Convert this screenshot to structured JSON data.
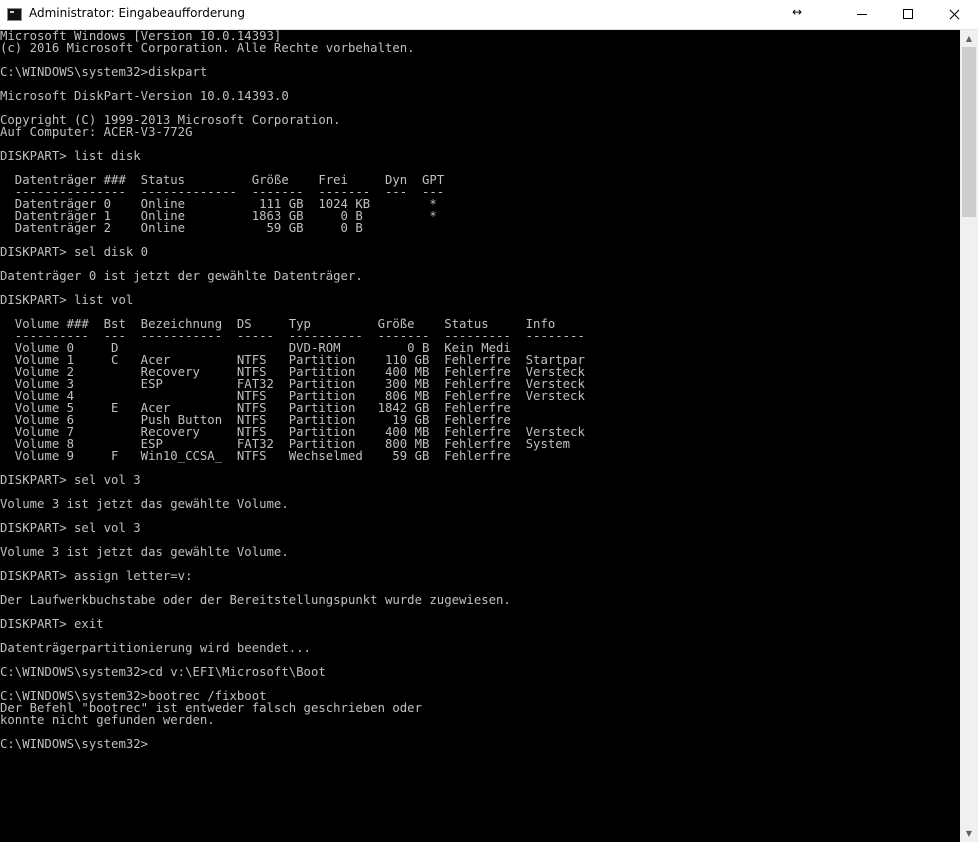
{
  "window": {
    "title": "Administrator: Eingabeaufforderung",
    "resize_glyph": "↔"
  },
  "console": {
    "lines": [
      "Microsoft Windows [Version 10.0.14393]",
      "(c) 2016 Microsoft Corporation. Alle Rechte vorbehalten.",
      "",
      "C:\\WINDOWS\\system32>diskpart",
      "",
      "Microsoft DiskPart-Version 10.0.14393.0",
      "",
      "Copyright (C) 1999-2013 Microsoft Corporation.",
      "Auf Computer: ACER-V3-772G",
      "",
      "DISKPART> list disk",
      "",
      "  Datenträger ###  Status         Größe    Frei     Dyn  GPT",
      "  ---------------  -------------  -------  -------  ---  ---",
      "  Datenträger 0    Online          111 GB  1024 KB        *",
      "  Datenträger 1    Online         1863 GB     0 B         *",
      "  Datenträger 2    Online           59 GB     0 B",
      "",
      "DISKPART> sel disk 0",
      "",
      "Datenträger 0 ist jetzt der gewählte Datenträger.",
      "",
      "DISKPART> list vol",
      "",
      "  Volume ###  Bst  Bezeichnung  DS     Typ         Größe    Status     Info",
      "  ----------  ---  -----------  -----  ----------  -------  ---------  --------",
      "  Volume 0     D                       DVD-ROM         0 B  Kein Medi",
      "  Volume 1     C   Acer         NTFS   Partition    110 GB  Fehlerfre  Startpar",
      "  Volume 2         Recovery     NTFS   Partition    400 MB  Fehlerfre  Versteck",
      "  Volume 3         ESP          FAT32  Partition    300 MB  Fehlerfre  Versteck",
      "  Volume 4                      NTFS   Partition    806 MB  Fehlerfre  Versteck",
      "  Volume 5     E   Acer         NTFS   Partition   1842 GB  Fehlerfre",
      "  Volume 6         Push Button  NTFS   Partition     19 GB  Fehlerfre",
      "  Volume 7         Recovery     NTFS   Partition    400 MB  Fehlerfre  Versteck",
      "  Volume 8         ESP          FAT32  Partition    800 MB  Fehlerfre  System",
      "  Volume 9     F   Win10_CCSA_  NTFS   Wechselmed    59 GB  Fehlerfre",
      "",
      "DISKPART> sel vol 3",
      "",
      "Volume 3 ist jetzt das gewählte Volume.",
      "",
      "DISKPART> sel vol 3",
      "",
      "Volume 3 ist jetzt das gewählte Volume.",
      "",
      "DISKPART> assign letter=v:",
      "",
      "Der Laufwerkbuchstabe oder der Bereitstellungspunkt wurde zugewiesen.",
      "",
      "DISKPART> exit",
      "",
      "Datenträgerpartitionierung wird beendet...",
      "",
      "C:\\WINDOWS\\system32>cd v:\\EFI\\Microsoft\\Boot",
      "",
      "C:\\WINDOWS\\system32>bootrec /fixboot",
      "Der Befehl \"bootrec\" ist entweder falsch geschrieben oder",
      "konnte nicht gefunden werden.",
      "",
      "C:\\WINDOWS\\system32>"
    ]
  },
  "scrollbar": {
    "up_glyph": "▲",
    "down_glyph": "▼"
  }
}
